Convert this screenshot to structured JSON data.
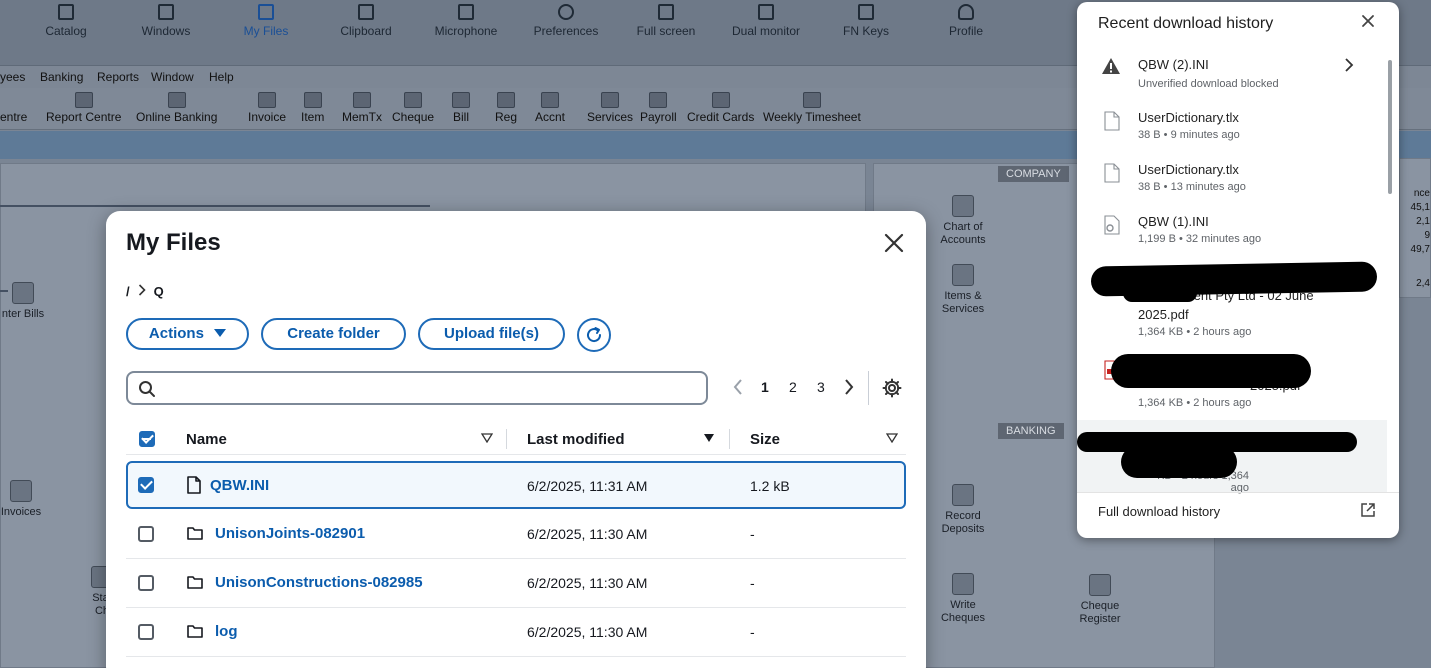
{
  "topbar": {
    "buttons": [
      {
        "label": "Catalog",
        "icon": "plus-box-icon"
      },
      {
        "label": "Windows",
        "icon": "window-icon"
      },
      {
        "label": "My Files",
        "icon": "file-icon",
        "active": true
      },
      {
        "label": "Clipboard",
        "icon": "clipboard-icon"
      },
      {
        "label": "Microphone",
        "icon": "microphone-icon"
      },
      {
        "label": "Preferences",
        "icon": "gear-icon"
      },
      {
        "label": "Full screen",
        "icon": "fullscreen-icon"
      },
      {
        "label": "Dual monitor",
        "icon": "dual-monitor-icon"
      },
      {
        "label": "FN Keys",
        "icon": "keyboard-icon"
      },
      {
        "label": "Profile",
        "icon": "user-icon"
      }
    ]
  },
  "app_menu": [
    "yees",
    "Banking",
    "Reports",
    "Window",
    "Help"
  ],
  "app_toolbar": [
    "entre",
    "Report Centre",
    "Online Banking",
    "Invoice",
    "Item",
    "MemTx",
    "Cheque",
    "Bill",
    "Reg",
    "Accnt",
    "Services",
    "Payroll",
    "Credit Cards",
    "Weekly Timesheet"
  ],
  "home": {
    "company_label": "COMPANY",
    "banking_label": "BANKING",
    "icons": {
      "enter_bills": "nter Bills",
      "invoices": "Invoices",
      "chart_of_accounts": "Chart of\nAccounts",
      "items_services": "Items &\nServices",
      "record_deposits": "Record\nDeposits",
      "write_cheques": "Write\nCheques",
      "cheque_register": "Cheque\nRegister",
      "stat_ch": "Stat\nCh"
    },
    "side_numbers": [
      "nce",
      "45,1",
      "2,1",
      "9",
      "49,7",
      "2,4"
    ]
  },
  "my_files": {
    "title": "My Files",
    "breadcrumb_root": "/",
    "breadcrumb_current": "Q",
    "actions_label": "Actions",
    "create_folder_label": "Create folder",
    "upload_label": "Upload file(s)",
    "search_placeholder": "",
    "pages": [
      "1",
      "2",
      "3"
    ],
    "current_page": "1",
    "columns": {
      "name": "Name",
      "modified": "Last modified",
      "size": "Size"
    },
    "rows": [
      {
        "type": "file",
        "name": "QBW.INI",
        "modified": "6/2/2025, 11:31 AM",
        "size": "1.2 kB",
        "selected": true
      },
      {
        "type": "folder",
        "name": "UnisonJoints-082901",
        "modified": "6/2/2025, 11:30 AM",
        "size": "-",
        "selected": false
      },
      {
        "type": "folder",
        "name": "UnisonConstructions-082985",
        "modified": "6/2/2025, 11:30 AM",
        "size": "-",
        "selected": false
      },
      {
        "type": "folder",
        "name": "log",
        "modified": "6/2/2025, 11:30 AM",
        "size": "-",
        "selected": false
      }
    ]
  },
  "download_history": {
    "title": "Recent download history",
    "items": [
      {
        "name": "QBW (2).INI",
        "meta": "Unverified download blocked",
        "icon": "warning-icon"
      },
      {
        "name": "UserDictionary.tlx",
        "meta": "38 B • 9 minutes ago",
        "icon": "file-icon"
      },
      {
        "name": "UserDictionary.tlx",
        "meta": "38 B • 13 minutes ago",
        "icon": "file-icon"
      },
      {
        "name": "QBW (1).INI",
        "meta": "1,199 B • 32 minutes ago",
        "icon": "settings-file-icon"
      },
      {
        "name_tail": "nt Statement Pty Ltd - 02 June",
        "name_line2": "2025.pdf",
        "meta": "1,364 KB • 2 hours ago",
        "icon": "pdf-icon"
      },
      {
        "name_tail": "2025.pdf",
        "meta": "1,364 KB • 2 hours ago",
        "icon": "pdf-icon"
      },
      {
        "meta_tail": "1,364 KB • 2 hours ago",
        "icon": "pdf-icon"
      }
    ],
    "full_history_label": "Full download history"
  }
}
